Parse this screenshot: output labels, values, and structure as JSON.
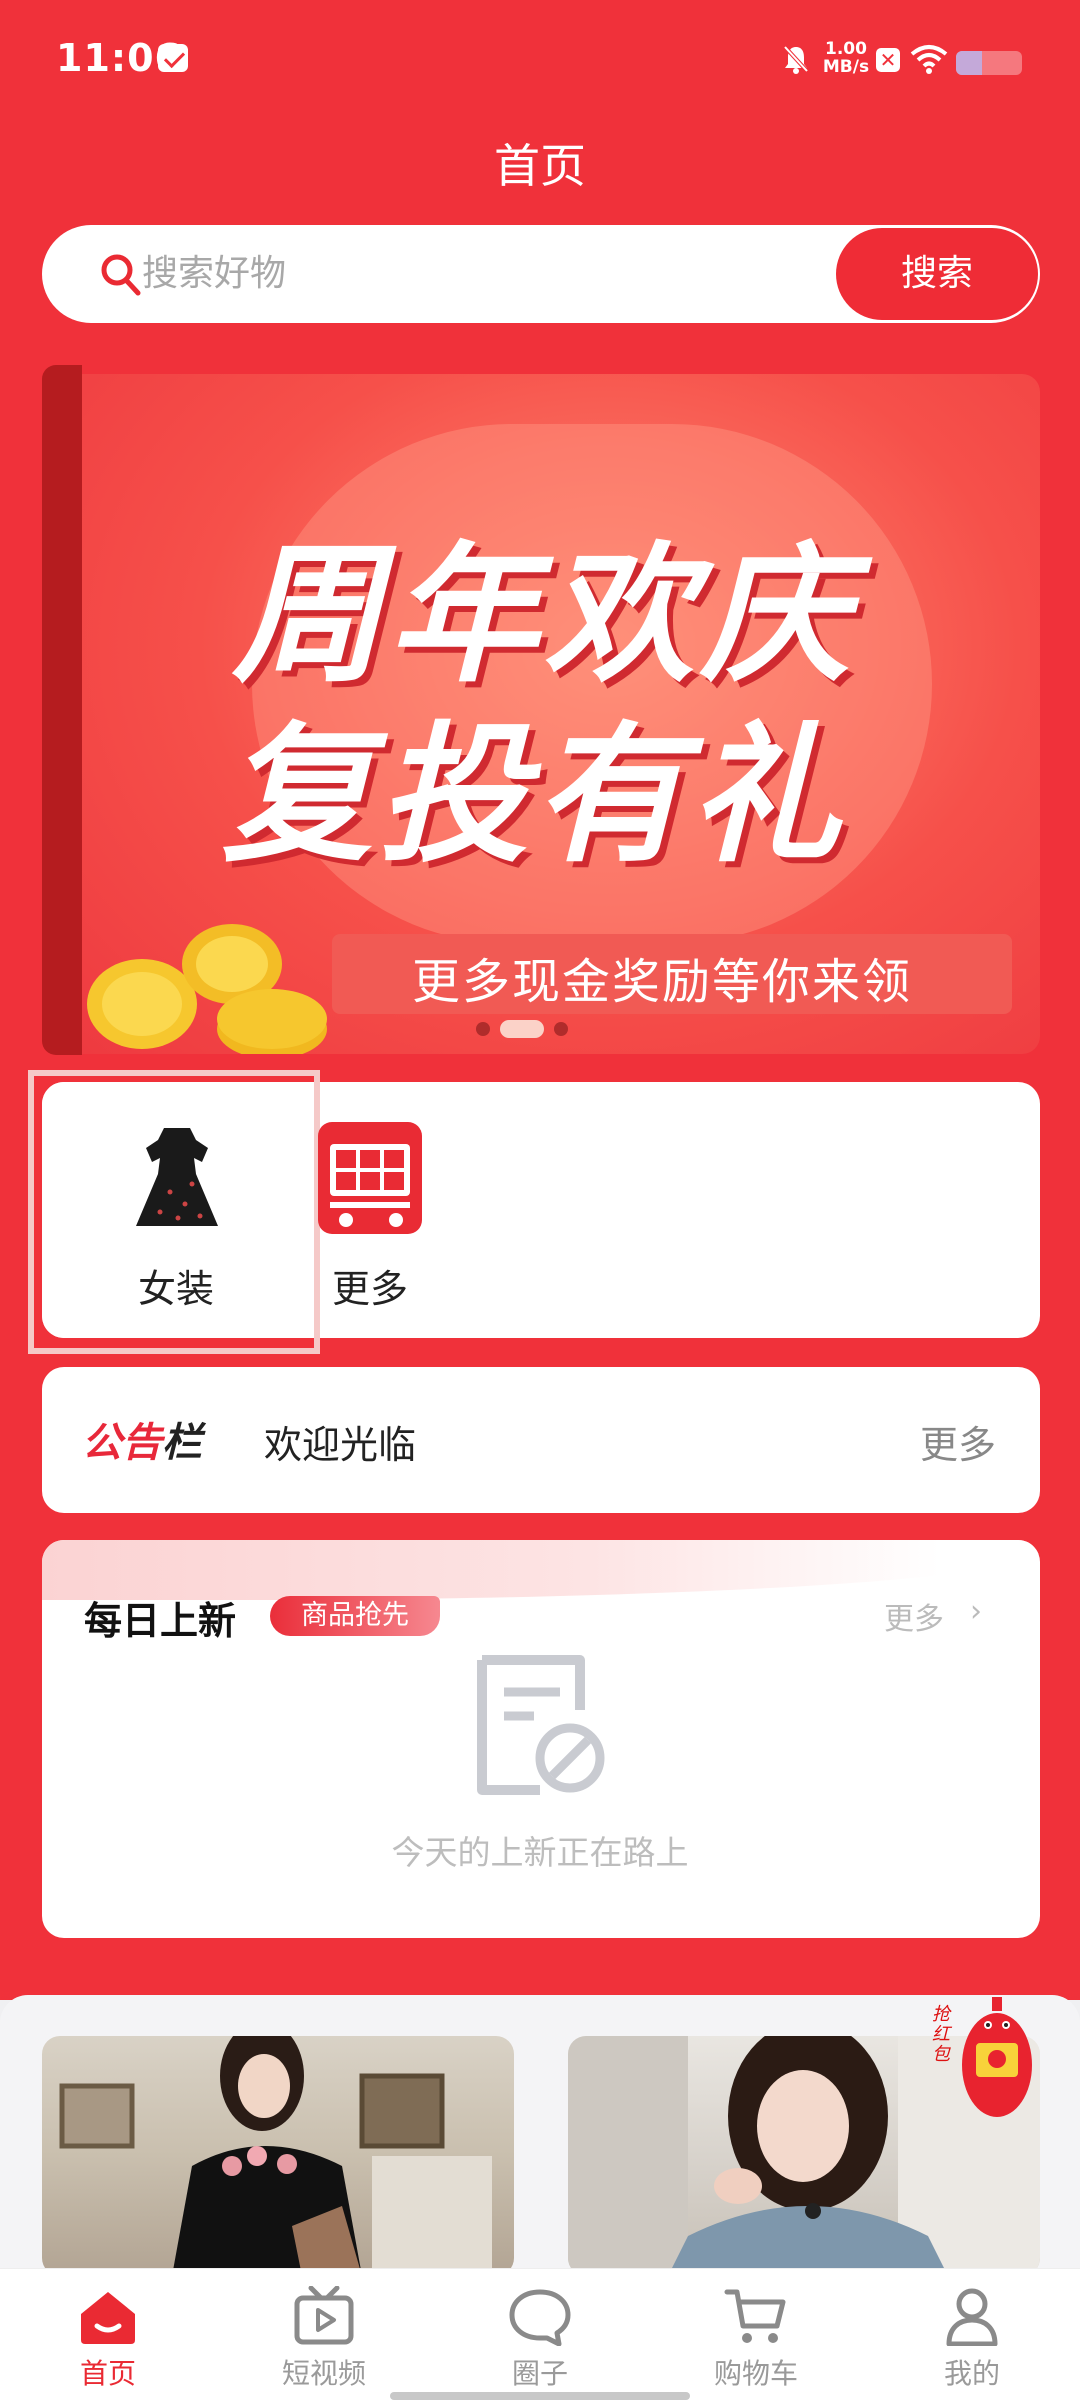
{
  "status_bar": {
    "time": "11:06",
    "network_speed_value": "1.00",
    "network_speed_unit": "MB/s",
    "battery_level": 0.4
  },
  "header": {
    "title": "首页"
  },
  "search": {
    "placeholder": "搜索好物",
    "button_label": "搜索"
  },
  "banner": {
    "title_line1": "周年欢庆",
    "title_line2": "复投有礼",
    "subtitle": "更多现金奖励等你来领",
    "slide_count": 3,
    "active_index": 1
  },
  "categories": [
    {
      "label": "女装",
      "icon": "dress-icon"
    },
    {
      "label": "更多",
      "icon": "shopping-cart-icon"
    }
  ],
  "notice": {
    "logo_part1": "公告",
    "logo_part2": "栏",
    "message": "欢迎光临",
    "more_label": "更多"
  },
  "daily_new": {
    "title": "每日上新",
    "tag": "商品抢先",
    "more_label": "更多",
    "empty_text": "今天的上新正在路上"
  },
  "products": [
    {
      "image": "woman-in-black-dress-photo"
    },
    {
      "image": "woman-in-denim-top-photo"
    }
  ],
  "floating_promo": {
    "text": "抢红包"
  },
  "bottom_nav": [
    {
      "label": "首页",
      "icon": "home-icon",
      "active": true
    },
    {
      "label": "短视频",
      "icon": "video-icon",
      "active": false
    },
    {
      "label": "圈子",
      "icon": "chat-bubble-icon",
      "active": false
    },
    {
      "label": "购物车",
      "icon": "cart-icon",
      "active": false
    },
    {
      "label": "我的",
      "icon": "user-icon",
      "active": false
    }
  ],
  "colors": {
    "brand_red": "#f0313a",
    "active_nav": "#ea2a33",
    "inactive_nav": "#9a9a9a"
  }
}
